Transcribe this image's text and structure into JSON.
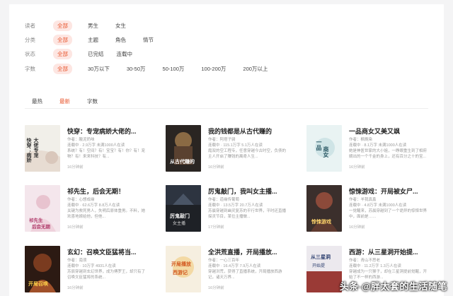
{
  "filters": [
    {
      "label": "读者",
      "options": [
        "全部",
        "男生",
        "女生"
      ],
      "active": 0
    },
    {
      "label": "分类",
      "options": [
        "全部",
        "主题",
        "角色",
        "情节"
      ],
      "active": 0
    },
    {
      "label": "状态",
      "options": [
        "全部",
        "已完结",
        "连载中"
      ],
      "active": 0
    },
    {
      "label": "字数",
      "options": [
        "全部",
        "30万以下",
        "30-50万",
        "50-100万",
        "100-200万",
        "200万以上"
      ],
      "active": 0
    }
  ],
  "tabs": [
    {
      "label": "最热",
      "active": false
    },
    {
      "label": "最新",
      "active": true
    },
    {
      "label": "字数",
      "active": false
    }
  ],
  "books": [
    {
      "title": "快穿：专宠病娇大佬的...",
      "author": "作者：酸泥奶味",
      "stats": "连载中 · 2.9万字   未满1000人在读",
      "desc": "系统？有！空间？有！宝宝？有！你？有！宠物？有！来来科技？有...",
      "time": "16分钟前",
      "cover_text": "快穿：病娇大佬专宠",
      "cover_color": "#f1efe9"
    },
    {
      "title": "我的钱都是从古代赚的",
      "author": "作者：阿塔子骑",
      "stats": "连载中 · 115.1万字   5.1万人在读",
      "desc": "霞双的空工程专，任意穿越今古时空，负债的主人开启了赚钱的离奇人生...",
      "time": "16分钟前",
      "cover_text": "从古代赚的",
      "cover_color": "#2a2522"
    },
    {
      "title": "一品商女又美又飒",
      "author": "作者：枫晚染",
      "stats": "连载中 · 8.1万字   未满1000人在读",
      "desc": "她是神医世家的大小姐，一睁眼重生到了相府嫡出的一个千金的身上，还有百分之十的宝...",
      "time": "16分钟前",
      "cover_text": "一品商女",
      "cover_color": "#e9f3f3"
    },
    {
      "title": "祁先生，后会无期！",
      "author": "作者：心想成缘",
      "stats": "连载中 · 62.6万字   8.8万人在读",
      "desc": "关键为救死男人，失明后原体重男。不料，她欢喜地嫁给他，但他...",
      "time": "16分钟前",
      "cover_text": "祁先生后会无期",
      "cover_color": "#f4e6ec"
    },
    {
      "title": "厉鬼敲门，我叫女主播...",
      "author": "作者：道缘传葡萄",
      "stats": "连载中 · 13.5万字   20.7万人在读",
      "desc": "苏晨穿越到幽灵复苏的平行世界，平时还直播探灵节目，某位主播做...",
      "time": "17分钟前",
      "cover_text": "厉鬼敲门",
      "cover_color": "#1e2126"
    },
    {
      "title": "惊悚游戏：开局被女尸...",
      "author": "作者：羊我真鑫",
      "stats": "连载中 · 4.8万字   未满1000人在读",
      "desc": "一觉醒来，苏晨穿越到了一个诡异的惊悚世界中，面前是……",
      "time": "16分钟前",
      "cover_text": "惊悚游戏",
      "cover_color": "#3b2f2c"
    },
    {
      "title": "玄幻：召唤文臣猛将当...",
      "author": "作者：南须",
      "stats": "连载中 · 10万字   4931人在读",
      "desc": "苏辰穿越到玄幻世界，成为傅罗王，却只有了召唤文臣猛将的系统...",
      "time": "16分钟前",
      "cover_text": "开局召唤",
      "cover_color": "#2c1a13"
    },
    {
      "title": "全洪荒直播，开局播放...",
      "author": "作者：一心三百年",
      "stats": "连载中 · 16.4万字   7.9万人在读",
      "desc": "穿越洪荒，获得了直播系统，开局播放西游记，诸天万界...",
      "time": "16分钟前",
      "cover_text": "开局播放西游记",
      "cover_color": "#f6efe0"
    },
    {
      "title": "西游：从三星洞开始提...",
      "author": "作者：青山不思老",
      "stats": "连载中 · 11.2万字   1.3万人在读",
      "desc": "穿越成为一只猴子，却在三星洞提前觉醒，开始了不一样的西游...",
      "time": "16分钟前",
      "cover_text": "从三星洞开始",
      "cover_color": "#ece9ee"
    }
  ],
  "watermark": "头条 @胖太套的生活随笔"
}
